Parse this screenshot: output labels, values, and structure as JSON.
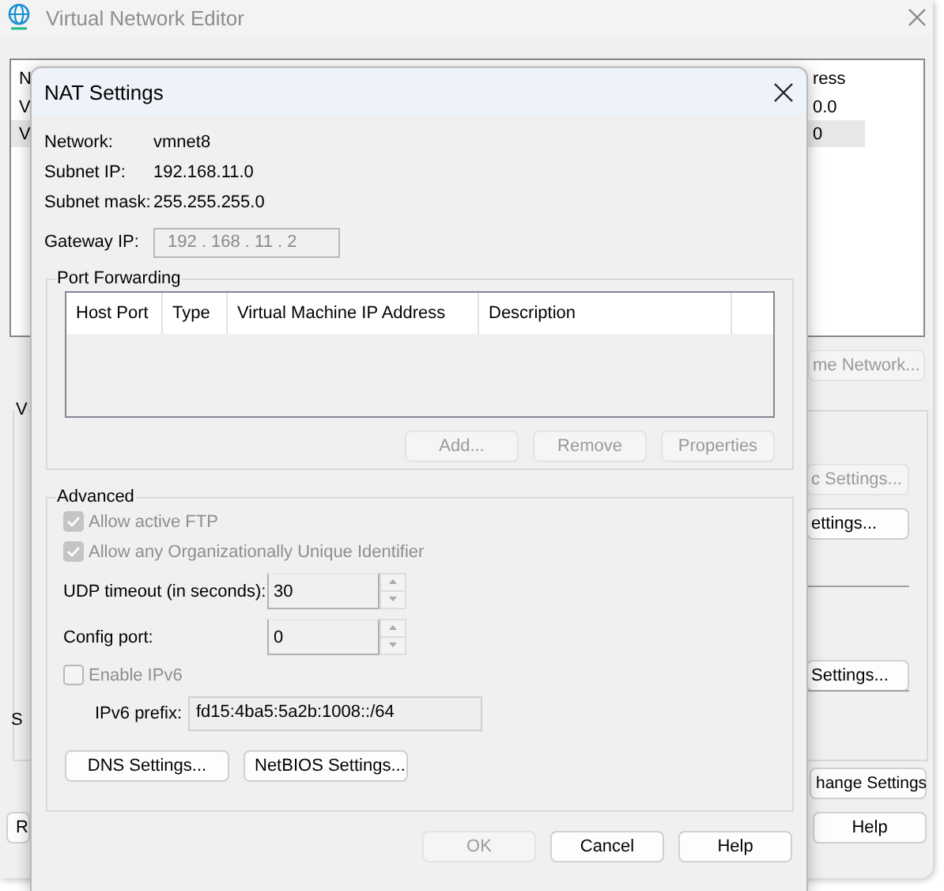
{
  "editor": {
    "title": "Virtual Network Editor",
    "list": {
      "columns": [
        "N",
        "ress"
      ],
      "rows": [
        {
          "cells": [
            "V",
            "0.0"
          ],
          "selected": false
        },
        {
          "cells": [
            "V",
            "0"
          ],
          "selected": true
        }
      ]
    },
    "rename_button": {
      "label": "me Network...",
      "disabled": true
    },
    "group_label": "V",
    "group_buttons": [
      {
        "label": "c Settings...",
        "disabled": true
      },
      {
        "label": "ettings...",
        "disabled": false
      },
      {
        "label": "Settings...",
        "disabled": false
      }
    ],
    "side_label": "S",
    "left_button": {
      "label": "R",
      "disabled": false
    },
    "right_buttons": [
      {
        "label": "hange Settings",
        "disabled": false
      },
      {
        "label": "Help",
        "disabled": false
      }
    ]
  },
  "nat_dialog": {
    "title": "NAT Settings",
    "info": [
      {
        "label": "Network:",
        "value": "vmnet8"
      },
      {
        "label": "Subnet IP:",
        "value": "192.168.11.0"
      },
      {
        "label": "Subnet mask:",
        "value": "255.255.255.0"
      }
    ],
    "gateway": {
      "label": "Gateway IP:",
      "value": "192 . 168 . 11 . 2",
      "disabled": true
    },
    "port_forwarding": {
      "title": "Port Forwarding",
      "columns": [
        "Host Port",
        "Type",
        "Virtual Machine IP Address",
        "Description"
      ],
      "buttons": [
        {
          "label": "Add...",
          "disabled": true
        },
        {
          "label": "Remove",
          "disabled": true
        },
        {
          "label": "Properties",
          "disabled": true
        }
      ]
    },
    "advanced": {
      "title": "Advanced",
      "options": [
        {
          "kind": "checkbox",
          "label": "Allow active FTP",
          "checked": true,
          "disabled": true
        },
        {
          "kind": "checkbox",
          "label": "Allow any Organizationally Unique Identifier",
          "checked": true,
          "disabled": true
        },
        {
          "kind": "spin",
          "label": "UDP timeout (in seconds):",
          "value": "30"
        },
        {
          "kind": "spin",
          "label": "Config port:",
          "value": "0"
        },
        {
          "kind": "checkbox",
          "label": "Enable IPv6",
          "checked": false,
          "disabled": true
        },
        {
          "kind": "text",
          "label": "IPv6 prefix:",
          "value": "fd15:4ba5:5a2b:1008::/64",
          "readonly": true
        }
      ],
      "buttons": [
        {
          "label": "DNS Settings...",
          "disabled": false
        },
        {
          "label": "NetBIOS Settings...",
          "disabled": false
        }
      ]
    },
    "buttons": [
      {
        "label": "OK",
        "disabled": true
      },
      {
        "label": "Cancel",
        "disabled": false
      },
      {
        "label": "Help",
        "disabled": false
      }
    ]
  }
}
